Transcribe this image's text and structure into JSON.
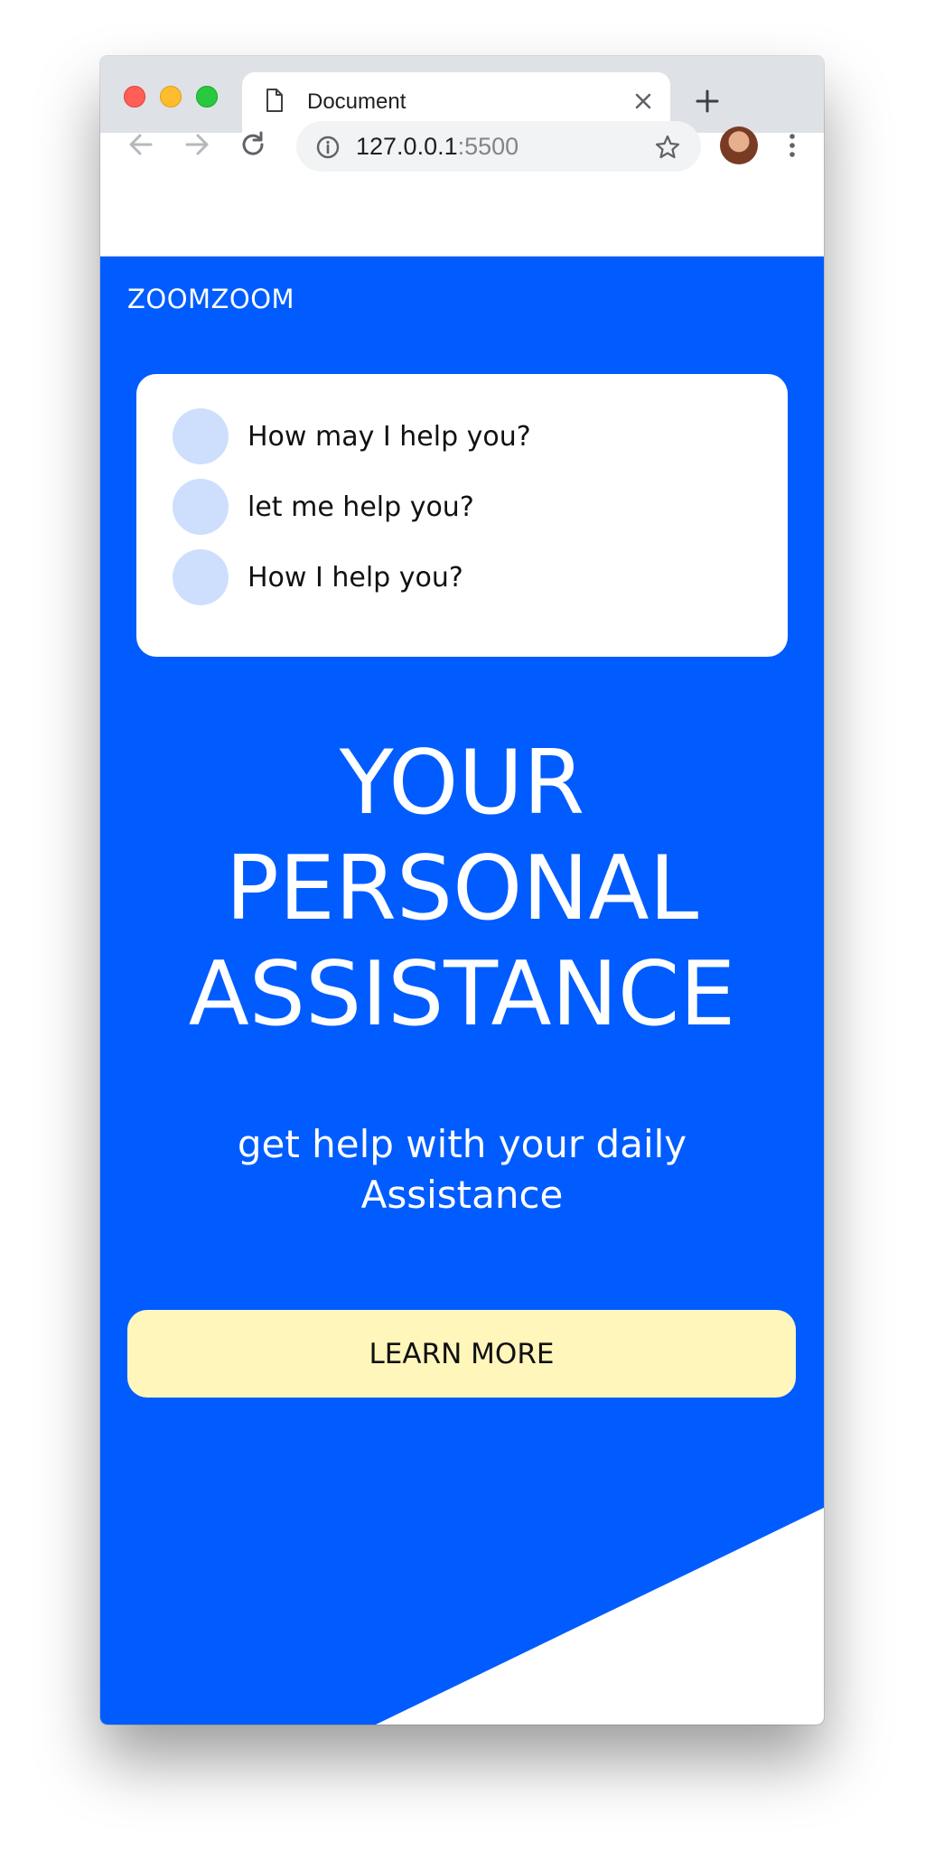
{
  "browser": {
    "tab_title": "Document",
    "url_host": "127.0.0.1",
    "url_port": ":5500",
    "icons": [
      "document-icon",
      "close-icon",
      "new-tab-icon",
      "back-icon",
      "forward-icon",
      "reload-icon",
      "info-icon",
      "star-icon",
      "profile-avatar",
      "menu-icon"
    ]
  },
  "page": {
    "brand": "ZOOMZOOM",
    "suggestions": [
      {
        "text": "How may I help you?"
      },
      {
        "text": "let me help you?"
      },
      {
        "text": "How I help you?"
      }
    ],
    "hero_lines": [
      "YOUR",
      "PERSONAL",
      "ASSISTANCE"
    ],
    "subtitle_lines": [
      "get help with your daily",
      "Assistance"
    ],
    "cta_label": "LEARN MORE"
  },
  "colors": {
    "page_background": "#005cff",
    "card_background": "#ffffff",
    "suggestion_dot": "#cddffc",
    "cta_background": "#fff6bc",
    "text_on_blue": "#ffffff"
  }
}
